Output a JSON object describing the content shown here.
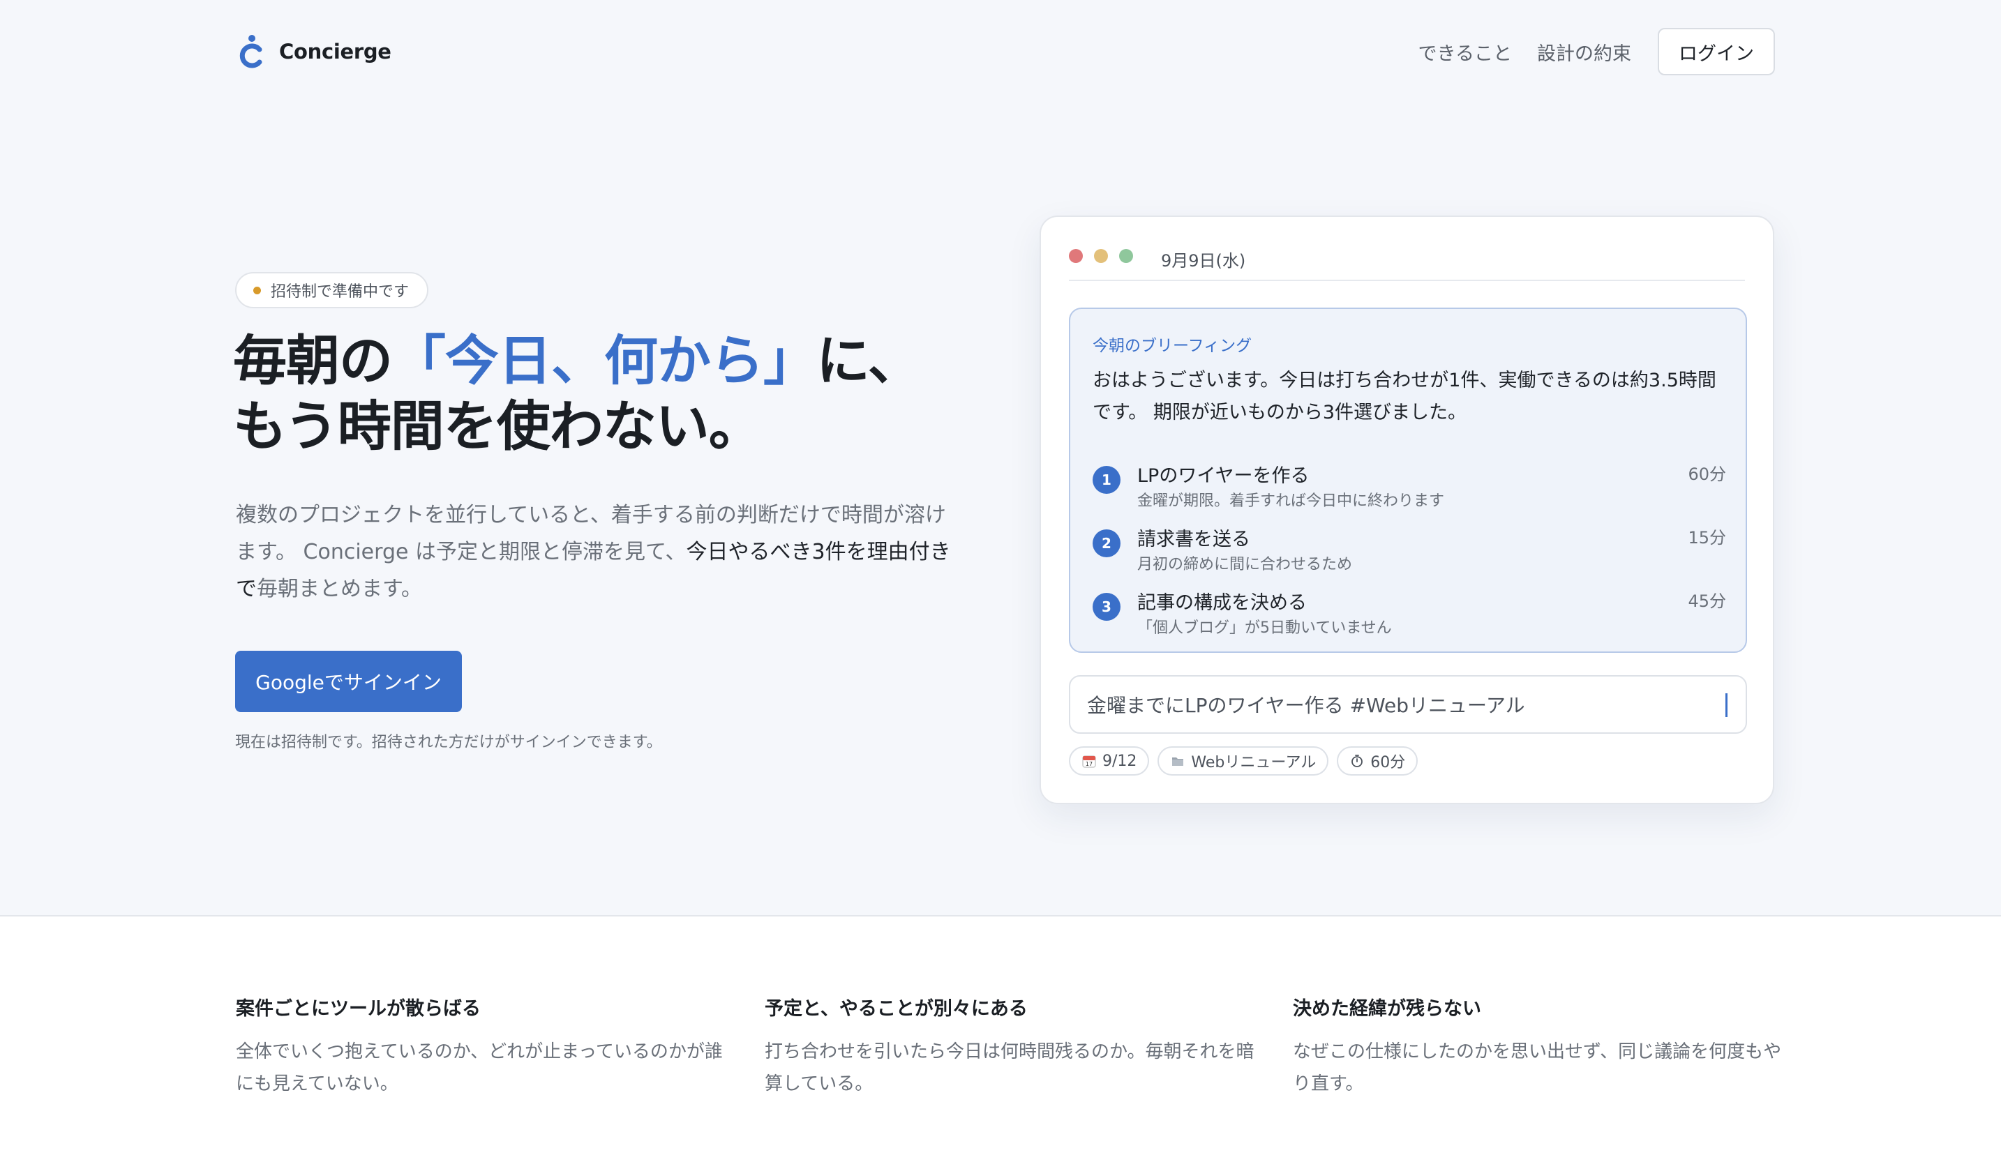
{
  "header": {
    "brand": "Concierge",
    "nav": [
      "できること",
      "設計の約束"
    ],
    "login_label": "ログイン"
  },
  "hero": {
    "badge": "招待制で準備中です",
    "headline_pre": "毎朝の",
    "headline_accent": "「今日、何から」",
    "headline_post": "に、",
    "headline_line2": "もう時間を使わない。",
    "lead_1": "複数のプロジェクトを並行していると、着手する前の判断だけで時間が溶けます。 Concierge は予定と期限と停滞を見て、",
    "lead_2": "今日やるべき3件を理由付きで",
    "lead_3": "毎朝まとめます。",
    "cta_label": "Googleでサインイン",
    "note": "現在は招待制です。招待された方だけがサインインできます。"
  },
  "card": {
    "date": "9月9日(水)",
    "brief_label": "今朝のブリーフィング",
    "summary": "おはようございます。今日は打ち合わせが1件、実働できるのは約3.5時間です。 期限が近いものから3件選びました。",
    "tasks": [
      {
        "num": "1",
        "title": "LPのワイヤーを作る",
        "sub": "金曜が期限。着手すれば今日中に終わります",
        "duration": "60分"
      },
      {
        "num": "2",
        "title": "請求書を送る",
        "sub": "月初の締めに間に合わせるため",
        "duration": "15分"
      },
      {
        "num": "3",
        "title": "記事の構成を決める",
        "sub": "「個人ブログ」が5日動いていません",
        "duration": "45分"
      }
    ],
    "input_value": "金曜までにLPのワイヤー作る #Webリニューアル",
    "chips": [
      {
        "icon": "calendar-icon",
        "label": "9/12"
      },
      {
        "icon": "folder-icon",
        "label": "Webリニューアル"
      },
      {
        "icon": "timer-icon",
        "label": "60分"
      }
    ]
  },
  "problems": [
    {
      "title": "案件ごとにツールが散らばる",
      "body": "全体でいくつ抱えているのか、どれが止まっているのかが誰にも見えていない。"
    },
    {
      "title": "予定と、やることが別々にある",
      "body": "打ち合わせを引いたら今日は何時間残るのか。毎朝それを暗算している。"
    },
    {
      "title": "決めた経緯が残らない",
      "body": "なぜこの仕様にしたのかを思い出せず、同じ議論を何度もやり直す。"
    }
  ],
  "colors": {
    "accent": "#3a6fc9",
    "badge_dot": "#d89a2a",
    "window_dots": [
      "#e0787a",
      "#e3c07a",
      "#8fc79c"
    ]
  }
}
